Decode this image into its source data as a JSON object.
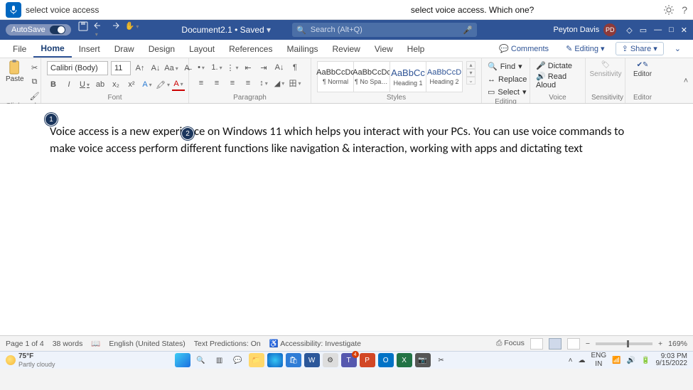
{
  "voice": {
    "input": "select voice access",
    "prompt": "select voice access. Which one?"
  },
  "qat": {
    "autosave": "AutoSave",
    "doc": "Document2.1 • Saved",
    "search_ph": "Search (Alt+Q)",
    "user": "Peyton Davis",
    "initials": "PD"
  },
  "tabs": {
    "list": [
      "File",
      "Home",
      "Insert",
      "Draw",
      "Design",
      "Layout",
      "References",
      "Mailings",
      "Review",
      "View",
      "Help"
    ],
    "active": 1,
    "comments": "Comments",
    "editing": "Editing",
    "share": "Share"
  },
  "ribbon": {
    "clipboard": {
      "label": "Clipboard",
      "paste": "Paste"
    },
    "font": {
      "label": "Font",
      "name": "Calibri (Body)",
      "size": "11"
    },
    "para": {
      "label": "Paragraph"
    },
    "styles": {
      "label": "Styles",
      "items": [
        {
          "prev": "AaBbCcDc",
          "name": "¶ Normal"
        },
        {
          "prev": "AaBbCcDc",
          "name": "¶ No Spac..."
        },
        {
          "prev": "AaBbCc",
          "name": "Heading 1",
          "color": "#2f5496"
        },
        {
          "prev": "AaBbCcD",
          "name": "Heading 2",
          "color": "#2f5496"
        }
      ]
    },
    "editing": {
      "label": "Editing",
      "find": "Find",
      "replace": "Replace",
      "select": "Select"
    },
    "voice": {
      "label": "Voice",
      "dictate": "Dictate",
      "read": "Read Aloud"
    },
    "sens": {
      "label": "Sensitivity",
      "btn": "Sensitivity"
    },
    "editor": {
      "label": "Editor",
      "btn": "Editor"
    }
  },
  "document": {
    "text": "Voice access is a new experience on Windows 11 which helps you interact with your PCs. You can use voice commands to make voice access perform different functions like navigation & interaction, working with apps and dictating text",
    "badge1": "1",
    "badge2": "2"
  },
  "status": {
    "page": "Page 1 of 4",
    "words": "38 words",
    "lang": "English (United States)",
    "pred": "Text Predictions: On",
    "acc": "Accessibility: Investigate",
    "focus": "Focus",
    "zoom": "169%"
  },
  "taskbar": {
    "temp": "75°F",
    "cond": "Partly cloudy",
    "lang": "ENG",
    "region": "IN",
    "time": "9:03 PM",
    "date": "9/15/2022",
    "teams_badge": "4"
  }
}
